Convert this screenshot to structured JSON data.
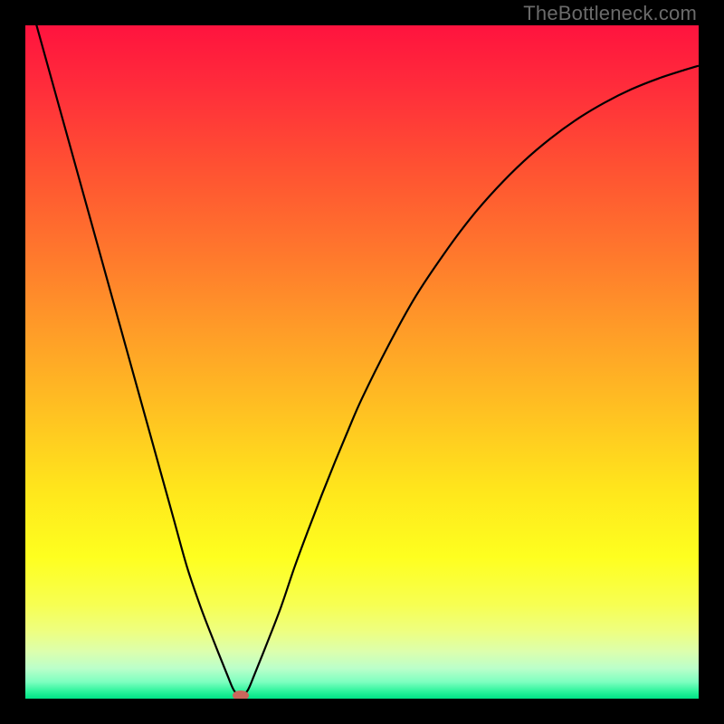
{
  "watermark": "TheBottleneck.com",
  "chart_data": {
    "type": "line",
    "title": "",
    "xlabel": "",
    "ylabel": "",
    "xlim": [
      0,
      100
    ],
    "ylim": [
      0,
      100
    ],
    "grid": false,
    "legend": false,
    "x": [
      0,
      2,
      4,
      6,
      8,
      10,
      12,
      14,
      16,
      18,
      20,
      22,
      24,
      26,
      28,
      30,
      31,
      32,
      33,
      34,
      36,
      38,
      40,
      42,
      44,
      46,
      48,
      50,
      54,
      58,
      62,
      66,
      70,
      74,
      78,
      82,
      86,
      90,
      94,
      98,
      100
    ],
    "values": [
      106,
      98.8,
      91.6,
      84.4,
      77.2,
      70.0,
      62.8,
      55.6,
      48.4,
      41.2,
      34.0,
      26.8,
      19.6,
      13.7,
      8.5,
      3.5,
      1.2,
      0.4,
      1.2,
      3.5,
      8.5,
      13.7,
      19.6,
      25.0,
      30.2,
      35.2,
      40.0,
      44.6,
      52.6,
      59.8,
      65.8,
      71.2,
      75.8,
      79.8,
      83.2,
      86.1,
      88.5,
      90.5,
      92.1,
      93.4,
      94.0
    ],
    "minimum_x": 32,
    "background": {
      "gradient_type": "linear-vertical",
      "stops": [
        {
          "offset": 0.0,
          "color": "#ff133e"
        },
        {
          "offset": 0.09,
          "color": "#ff2c3b"
        },
        {
          "offset": 0.21,
          "color": "#ff5132"
        },
        {
          "offset": 0.33,
          "color": "#ff752d"
        },
        {
          "offset": 0.45,
          "color": "#ff9b28"
        },
        {
          "offset": 0.57,
          "color": "#ffc022"
        },
        {
          "offset": 0.69,
          "color": "#ffe61c"
        },
        {
          "offset": 0.79,
          "color": "#feff1f"
        },
        {
          "offset": 0.86,
          "color": "#f7ff52"
        },
        {
          "offset": 0.9,
          "color": "#eeff80"
        },
        {
          "offset": 0.93,
          "color": "#dcffad"
        },
        {
          "offset": 0.955,
          "color": "#bbffca"
        },
        {
          "offset": 0.975,
          "color": "#7effc0"
        },
        {
          "offset": 0.99,
          "color": "#28f39a"
        },
        {
          "offset": 1.0,
          "color": "#00e286"
        }
      ]
    },
    "curve_color": "#000000",
    "marker_color": "#c9675c"
  }
}
